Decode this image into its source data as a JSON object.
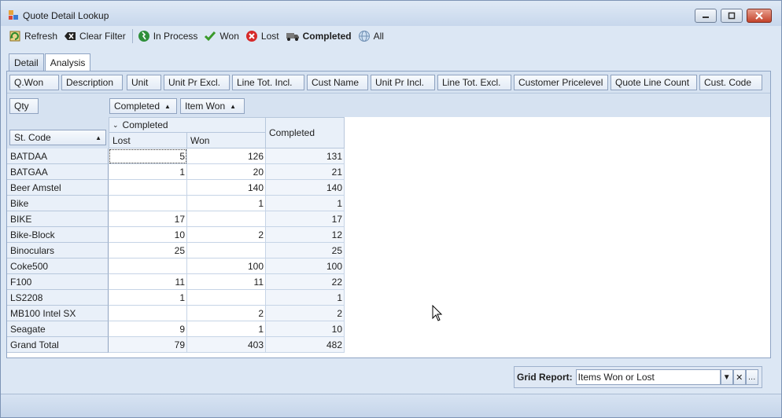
{
  "window": {
    "title": "Quote Detail Lookup"
  },
  "toolbar": {
    "refresh": "Refresh",
    "clear_filter": "Clear Filter",
    "in_process": "In Process",
    "won": "Won",
    "lost": "Lost",
    "completed": "Completed",
    "all": "All"
  },
  "tabs": [
    {
      "label": "Detail",
      "active": false
    },
    {
      "label": "Analysis",
      "active": true
    }
  ],
  "filter_fields": [
    "Q.Won",
    "Description",
    "Unit",
    "Unit Pr Excl.",
    "Line Tot. Incl.",
    "Cust Name",
    "Unit Pr Incl.",
    "Line Tot. Excl.",
    "Customer Pricelevel",
    "Quote Line Count",
    "Cust. Code"
  ],
  "pivot": {
    "data_field": "Qty",
    "column_fields": [
      "Completed",
      "Item Won"
    ],
    "row_field": "St. Code",
    "group_header": "Completed",
    "columns": [
      "Lost",
      "Won"
    ],
    "total_header": "Completed",
    "rows": [
      {
        "code": "BATDAA",
        "lost": "5",
        "won": "126",
        "total": "131"
      },
      {
        "code": "BATGAA",
        "lost": "1",
        "won": "20",
        "total": "21"
      },
      {
        "code": "Beer Amstel",
        "lost": "",
        "won": "140",
        "total": "140"
      },
      {
        "code": "Bike",
        "lost": "",
        "won": "1",
        "total": "1"
      },
      {
        "code": "BIKE",
        "lost": "17",
        "won": "",
        "total": "17"
      },
      {
        "code": "Bike-Block",
        "lost": "10",
        "won": "2",
        "total": "12"
      },
      {
        "code": "Binoculars",
        "lost": "25",
        "won": "",
        "total": "25"
      },
      {
        "code": "Coke500",
        "lost": "",
        "won": "100",
        "total": "100"
      },
      {
        "code": "F100",
        "lost": "11",
        "won": "11",
        "total": "22"
      },
      {
        "code": "LS2208",
        "lost": "1",
        "won": "",
        "total": "1"
      },
      {
        "code": "MB100 Intel SX",
        "lost": "",
        "won": "2",
        "total": "2"
      },
      {
        "code": "Seagate",
        "lost": "9",
        "won": "1",
        "total": "10"
      }
    ],
    "grand_total": {
      "code": "Grand Total",
      "lost": "79",
      "won": "403",
      "total": "482"
    }
  },
  "grid_report": {
    "label": "Grid Report:",
    "value": "Items Won or Lost"
  },
  "colors": {
    "accent": "#c4432b",
    "won_green": "#3a9a2a",
    "lost_red": "#d62a2a"
  }
}
